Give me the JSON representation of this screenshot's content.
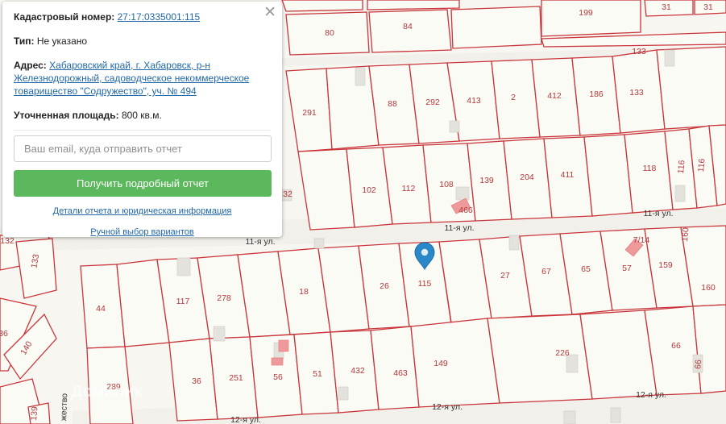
{
  "popup": {
    "cadastral_label": "Кадастровый номер:",
    "cadastral_value": "27:17:0335001:115",
    "type_label": "Тип:",
    "type_value": "Не указано",
    "address_label": "Адрес:",
    "address_value": "Хабаровский край, г. Хабаровск, р-н Железнодорожный, садоводческое некоммерческое товарищество \"Содружество\", уч. № 494",
    "area_label": "Уточненная площадь:",
    "area_value": "800 кв.м.",
    "email_placeholder": "Ваш email, куда отправить отчет",
    "get_report_button": "Получить подробный отчет",
    "details_link": "Детали отчета и юридическая информация",
    "manual_link": "Ручной выбор вариантов",
    "close_icon": "close-icon"
  },
  "map": {
    "watermark": "ДомКлик",
    "marker_icon": "map-pin-icon",
    "colors": {
      "parcel_border": "#c9353a",
      "label": "#b2383c",
      "marker": "#2a88c8",
      "button": "#5cb85c"
    },
    "streets": [
      "11-я ул.",
      "11-я ул.",
      "11-я ул.",
      "12-я ул.",
      "12-я ул.",
      "12-я ул.",
      "жество"
    ],
    "parcels": [
      "31",
      "31",
      "199",
      "80",
      "84",
      "133",
      "291",
      "88",
      "292",
      "413",
      "2",
      "412",
      "186",
      "133",
      "102",
      "112",
      "108",
      "139",
      "204",
      "411",
      "118",
      "116",
      "116",
      "32",
      "466",
      "7/14",
      "160",
      "132",
      "133",
      "44",
      "117",
      "278",
      "18",
      "26",
      "115",
      "27",
      "67",
      "65",
      "57",
      "159",
      "160",
      "36",
      "140",
      "289",
      "36",
      "251",
      "56",
      "51",
      "432",
      "463",
      "149",
      "226",
      "66",
      "66",
      "139"
    ]
  }
}
